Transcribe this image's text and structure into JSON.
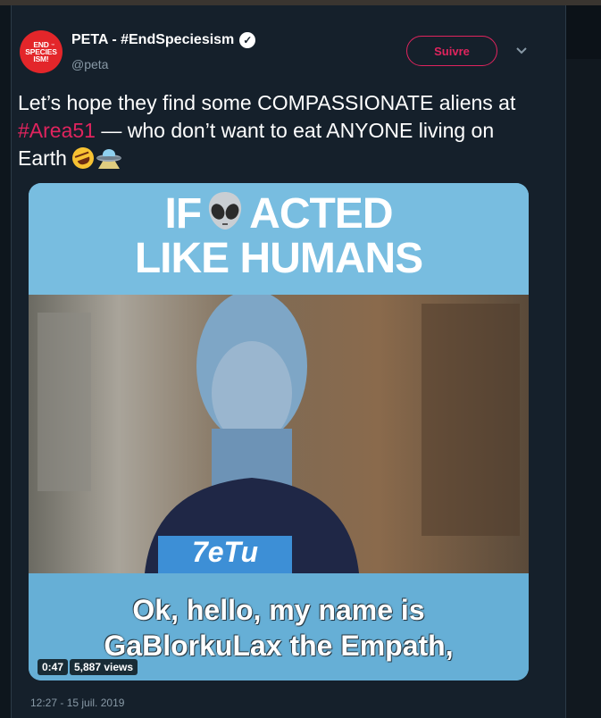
{
  "author": {
    "avatar_text": [
      "END",
      "SPECIES",
      "ISM!"
    ],
    "avatar_tm": "™",
    "display_name": "PETA - #EndSpeciesism",
    "handle": "@peta",
    "verified": true
  },
  "follow_button": {
    "label": "Suivre"
  },
  "tweet": {
    "text_part1": "Let’s hope they find some COMPASSIONATE aliens at ",
    "hashtag": "#Area51",
    "text_part2": " — who don’t want to eat ANYONE living on Earth ",
    "emojis": [
      "rolling-on-floor-laughing",
      "flying-saucer"
    ]
  },
  "video": {
    "headline_line1_a": "IF",
    "headline_line1_b": "ACTED",
    "headline_line2": "LIKE HUMANS",
    "shirt_text": "7eTu",
    "caption_line1": "Ok, hello, my name is",
    "caption_line2": "GaBlorkuLax the Empath,",
    "duration": "0:47",
    "views": "5,887 views"
  },
  "timestamp": "12:27 - 15 juil. 2019",
  "colors": {
    "background": "#15202b",
    "accent": "#e0245e",
    "secondary_text": "#8899a6",
    "avatar_red": "#e3262a"
  }
}
